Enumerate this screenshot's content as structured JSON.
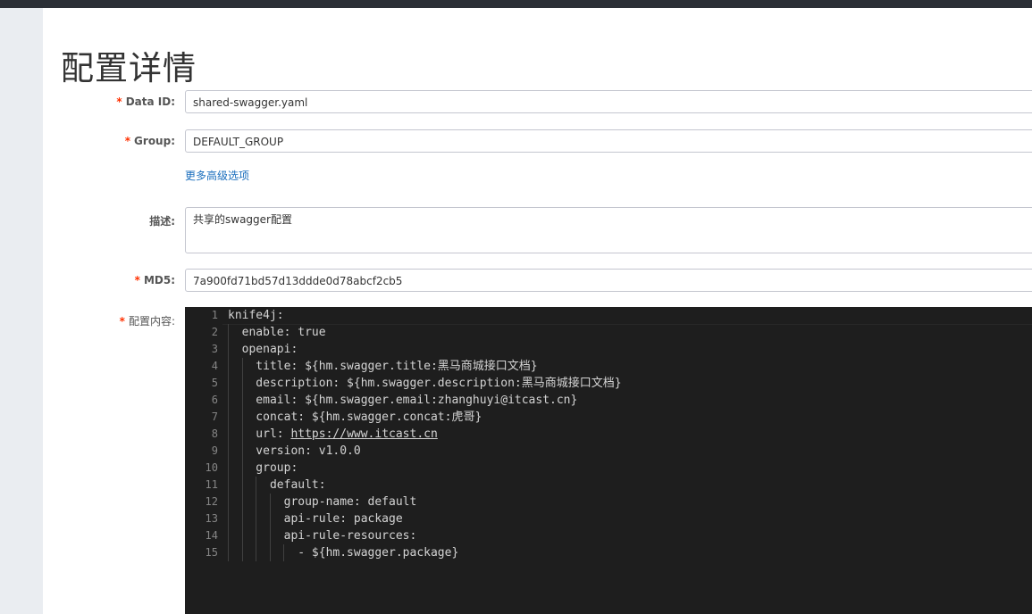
{
  "page": {
    "title": "配置详情"
  },
  "form": {
    "data_id": {
      "label": "Data ID:",
      "required": "*",
      "value": "shared-swagger.yaml"
    },
    "group": {
      "label": "Group:",
      "required": "*",
      "value": "DEFAULT_GROUP"
    },
    "more_options_link": "更多高级选项",
    "description": {
      "label": "描述:",
      "value": "共享的swagger配置"
    },
    "md5": {
      "label": "MD5:",
      "required": "*",
      "value": "7a900fd71bd57d13ddde0d78abcf2cb5"
    },
    "content": {
      "label": "配置内容:",
      "required": "*"
    }
  },
  "editor": {
    "lines": [
      {
        "n": "1",
        "text": "knife4j:"
      },
      {
        "n": "2",
        "text": "  enable: true"
      },
      {
        "n": "3",
        "text": "  openapi:"
      },
      {
        "n": "4",
        "text": "    title: ${hm.swagger.title:黑马商城接口文档}"
      },
      {
        "n": "5",
        "text": "    description: ${hm.swagger.description:黑马商城接口文档}"
      },
      {
        "n": "6",
        "text": "    email: ${hm.swagger.email:zhanghuyi@itcast.cn}"
      },
      {
        "n": "7",
        "text": "    concat: ${hm.swagger.concat:虎哥}"
      },
      {
        "n": "8",
        "text": "    url: ",
        "link": "https://www.itcast.cn"
      },
      {
        "n": "9",
        "text": "    version: v1.0.0"
      },
      {
        "n": "10",
        "text": "    group:"
      },
      {
        "n": "11",
        "text": "      default:"
      },
      {
        "n": "12",
        "text": "        group-name: default"
      },
      {
        "n": "13",
        "text": "        api-rule: package"
      },
      {
        "n": "14",
        "text": "        api-rule-resources:"
      },
      {
        "n": "15",
        "text": "          - ${hm.swagger.package}"
      }
    ]
  }
}
